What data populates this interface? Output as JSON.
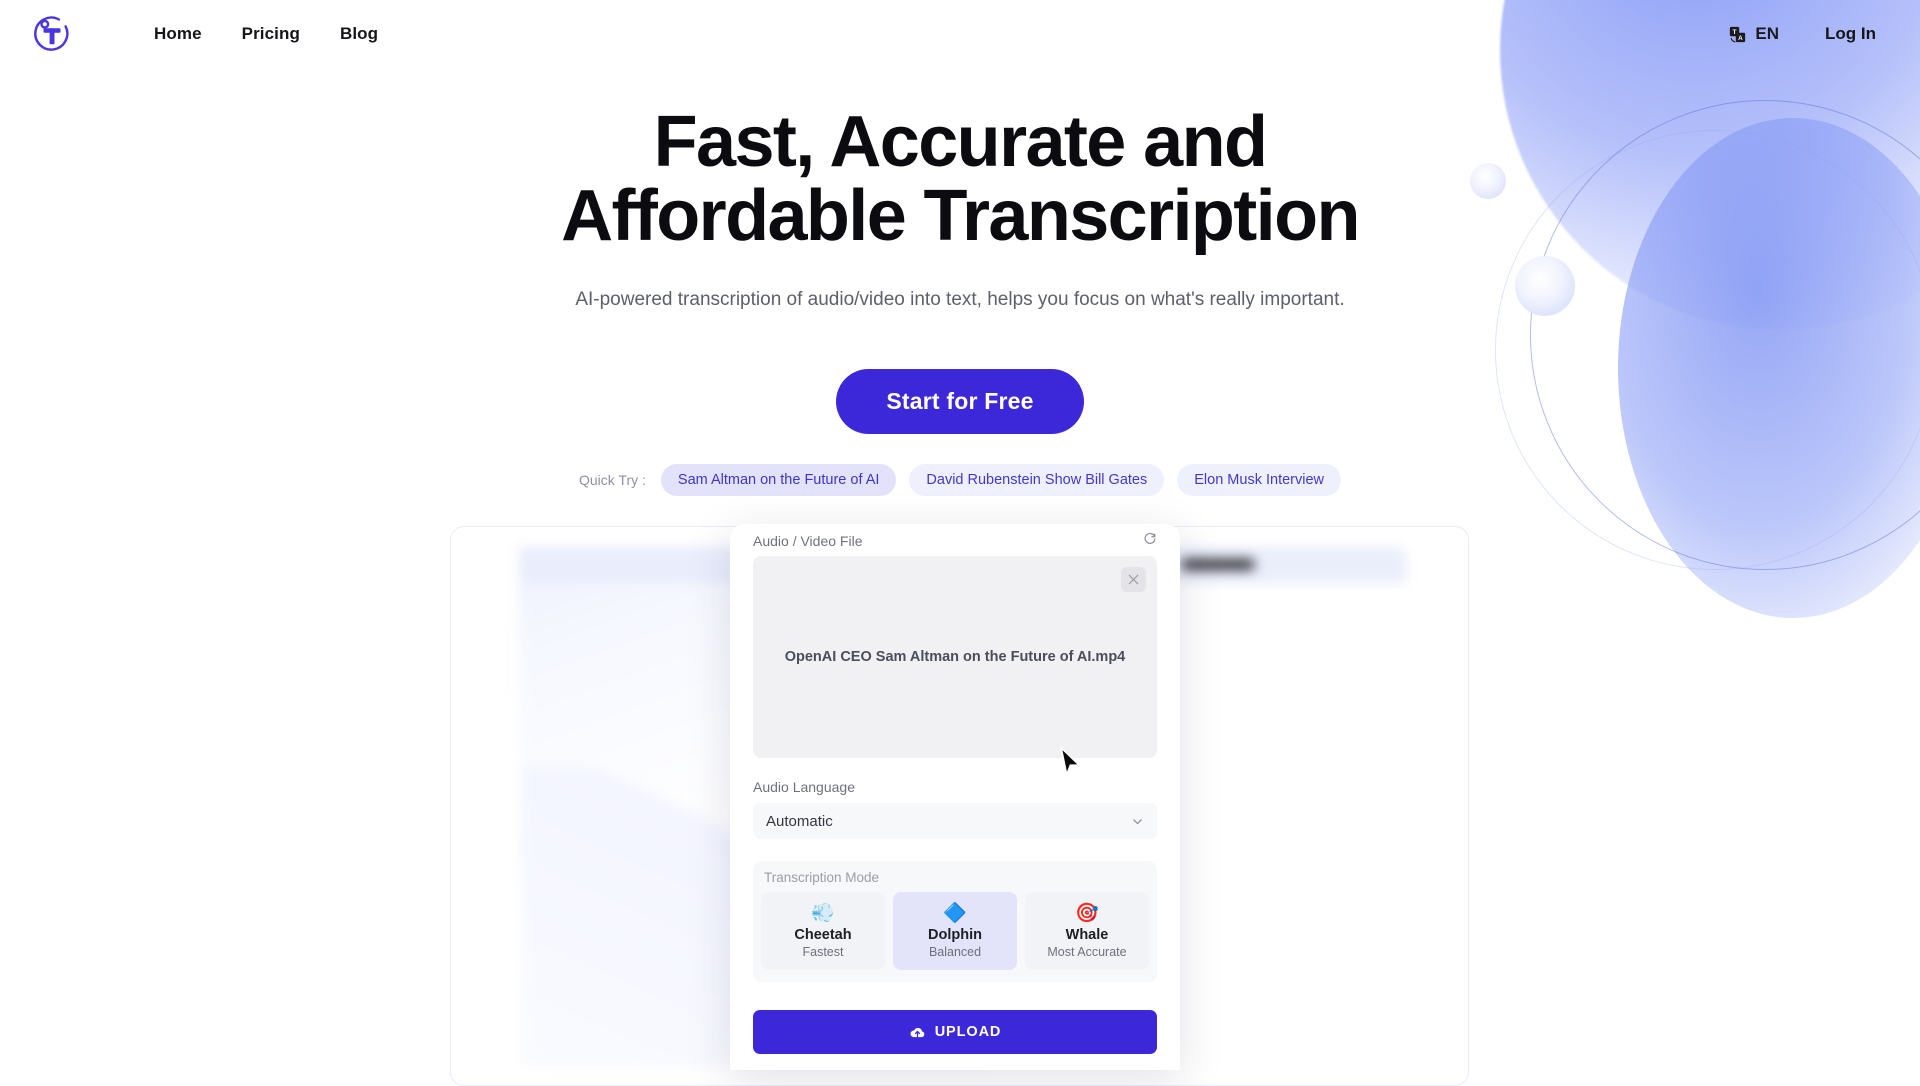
{
  "header": {
    "logo_alt": "Transcription logo",
    "nav": [
      {
        "label": "Home"
      },
      {
        "label": "Pricing"
      },
      {
        "label": "Blog"
      }
    ],
    "language": {
      "code": "EN",
      "icon": "translate-icon"
    },
    "login_label": "Log In"
  },
  "hero": {
    "title_line1": "Fast, Accurate and",
    "title_line2": "Affordable Transcription",
    "subtitle": "AI-powered transcription of audio/video into text, helps you focus on what's really important.",
    "cta_label": "Start for Free",
    "quick_try_label": "Quick Try :",
    "quick_try_chips": [
      {
        "label": "Sam Altman on the Future of AI",
        "active": true
      },
      {
        "label": "David Rubenstein Show Bill Gates",
        "active": false
      },
      {
        "label": "Elon Musk Interview",
        "active": false
      }
    ]
  },
  "modal": {
    "file_section_label": "Audio / Video File",
    "refresh_icon": "refresh-icon",
    "close_icon": "close-icon",
    "file_name": "OpenAI CEO Sam Altman on the Future of AI.mp4",
    "language_label": "Audio Language",
    "language_value": "Automatic",
    "language_chevron": "chevron-down-icon",
    "mode_section_title": "Transcription Mode",
    "modes": [
      {
        "name": "Cheetah",
        "desc": "Fastest",
        "emoji": "💨",
        "selected": false
      },
      {
        "name": "Dolphin",
        "desc": "Balanced",
        "emoji": "🔷",
        "selected": true
      },
      {
        "name": "Whale",
        "desc": "Most Accurate",
        "emoji": "🎯",
        "selected": false
      }
    ],
    "upload_label": "UPLOAD",
    "upload_icon": "cloud-upload-icon"
  },
  "colors": {
    "accent": "#3d28d9",
    "chip_text": "#4338ca",
    "chip_bg": "#eef0fd",
    "chip_active_bg": "#e2e3fb",
    "mode_selected_bg": "#e3e3fa",
    "heading": "#0c0c10",
    "muted": "#6f717f"
  }
}
